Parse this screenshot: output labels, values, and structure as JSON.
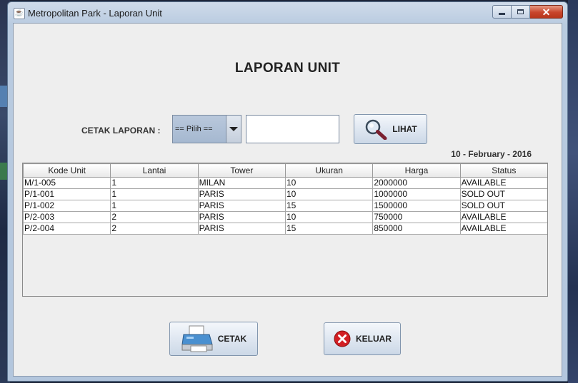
{
  "window": {
    "title": "Metropolitan Park - Laporan Unit",
    "icon": "java-icon"
  },
  "report": {
    "title": "LAPORAN UNIT",
    "cetak_label": "CETAK LAPORAN   :",
    "combo_value": "== Pilih ==",
    "input_value": "",
    "date": "10 - February - 2016"
  },
  "buttons": {
    "lihat": "LIHAT",
    "cetak": "CETAK",
    "keluar": "KELUAR"
  },
  "table": {
    "headers": [
      "Kode Unit",
      "Lantai",
      "Tower",
      "Ukuran",
      "Harga",
      "Status"
    ],
    "rows": [
      [
        "M/1-005",
        "1",
        "MILAN",
        "10",
        "2000000",
        "AVAILABLE"
      ],
      [
        "P/1-001",
        "1",
        "PARIS",
        "10",
        "1000000",
        "SOLD OUT"
      ],
      [
        "P/1-002",
        "1",
        "PARIS",
        "15",
        "1500000",
        "SOLD OUT"
      ],
      [
        "P/2-003",
        "2",
        "PARIS",
        "10",
        "750000",
        "AVAILABLE"
      ],
      [
        "P/2-004",
        "2",
        "PARIS",
        "15",
        "850000",
        "AVAILABLE"
      ]
    ]
  },
  "colors": {
    "close_button": "#c8452c",
    "client_bg": "#eeeeee",
    "combo_bg": "#a5b8d0"
  }
}
